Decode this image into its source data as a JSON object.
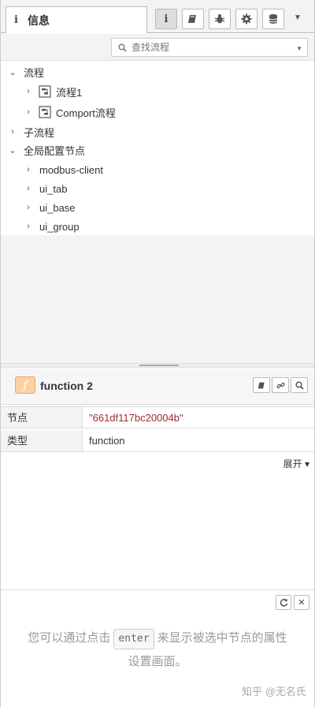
{
  "tabs": {
    "info_label": "信息",
    "active": "info"
  },
  "toolbar_icons": [
    "info-icon",
    "book-icon",
    "bug-icon",
    "gear-icon",
    "database-icon",
    "caret-down-icon"
  ],
  "search": {
    "placeholder": "查找流程"
  },
  "tree": {
    "flows_label": "流程",
    "flows": [
      "流程1",
      "Comport流程"
    ],
    "subflows_label": "子流程",
    "config_label": "全局配置节点",
    "config_nodes": [
      "modbus-client",
      "ui_tab",
      "ui_base",
      "ui_group"
    ]
  },
  "node": {
    "icon_letter": "ƒ",
    "title": "function 2",
    "props": [
      {
        "key": "节点",
        "value": "\"661df117bc20004b\""
      },
      {
        "key": "类型",
        "value": "function"
      }
    ],
    "expand_label": "展开 ▾"
  },
  "help": {
    "tip_before": "您可以通过点击",
    "key": "enter",
    "tip_after": "来显示被选中节点的属性",
    "tip_line2": "设置画面。"
  },
  "watermark": "知乎 @无名氏"
}
